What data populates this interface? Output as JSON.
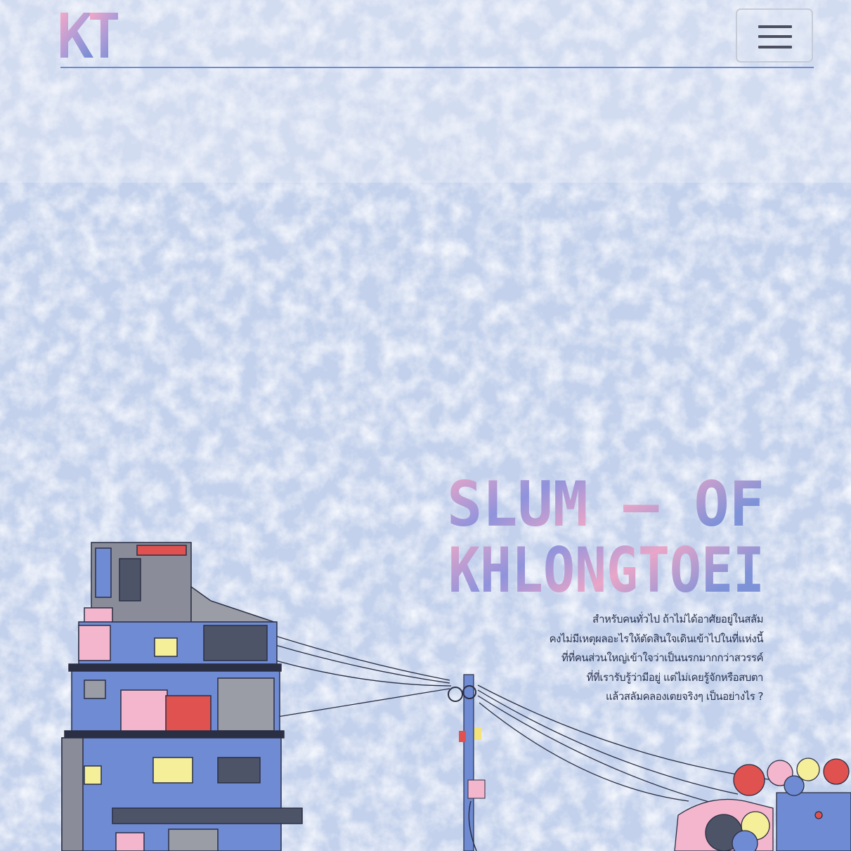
{
  "header": {
    "logo_text": "KT",
    "menu_icon": "hamburger-icon"
  },
  "hero": {
    "title_line1": "SLUM — OF",
    "title_line2": "KHLONGTOEI",
    "blurb": [
      "สำหรับคนทั่วไป ถ้าไม่ได้อาศัยอยู่ในสลัม",
      "คงไม่มีเหตุผลอะไรให้ตัดสินใจเดินเข้าไปในที่แห่งนี้",
      "ที่ที่คนส่วนใหญ่เข้าใจว่าเป็นนรกมากกว่าสวรรค์",
      "ที่ที่เรารับรู้ว่ามีอยู่ แต่ไม่เคยรู้จักหรือสบตา",
      "แล้วสลัมคลองเตยจริงๆ เป็นอย่างไร ?"
    ]
  },
  "colors": {
    "accent_blue": "#6f8bcf",
    "accent_pink": "#f0a9c6",
    "background": "#c9d6ee"
  }
}
